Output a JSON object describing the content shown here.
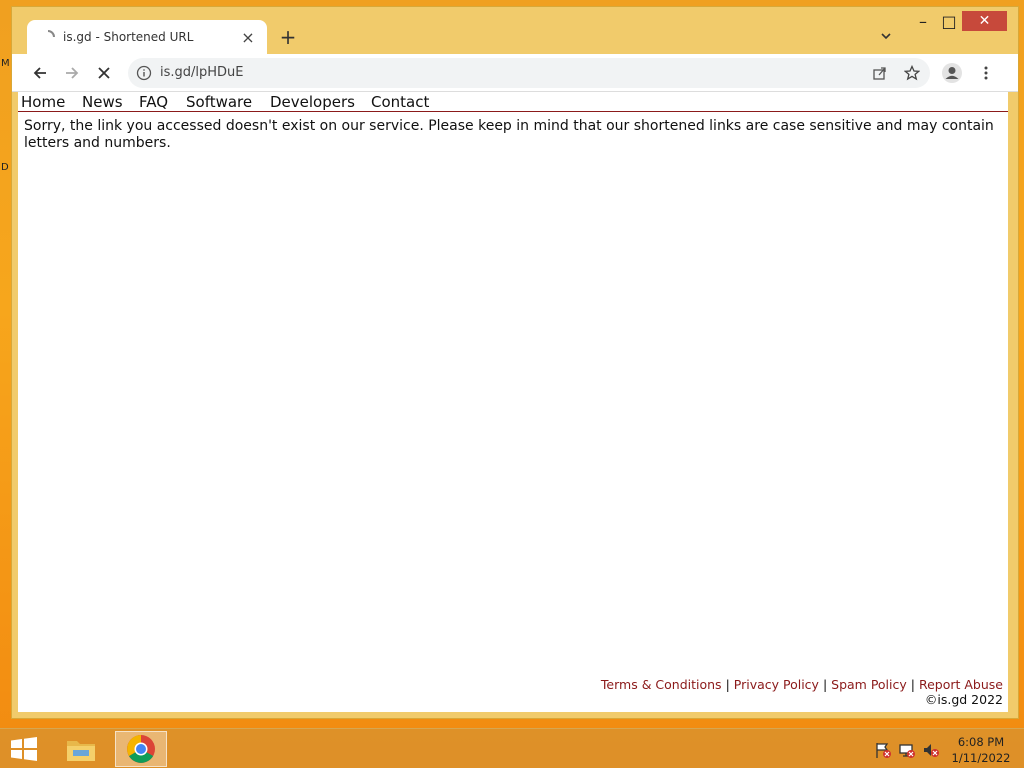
{
  "desktop": {
    "letters": [
      "M",
      "D"
    ]
  },
  "browser": {
    "tab_title": "is.gd - Shortened URL",
    "tab_close": "×",
    "new_tab": "+",
    "url": "is.gd/lpHDuE",
    "window_min": "–",
    "window_max": "□",
    "window_close": "✕"
  },
  "site": {
    "nav": [
      "Home",
      "News",
      "FAQ",
      "Software",
      "Developers",
      "Contact"
    ],
    "message": "Sorry, the link you accessed doesn't exist on our service. Please keep in mind that our shortened links are case sensitive and may contain letters and numbers.",
    "footer_links": [
      "Terms & Conditions",
      "Privacy Policy",
      "Spam Policy",
      "Report Abuse"
    ],
    "separator": "|",
    "copyright": "©is.gd 2022"
  },
  "taskbar": {
    "time": "6:08 PM",
    "date": "1/11/2022"
  },
  "colors": {
    "accent": "#8b1a1a",
    "titlebar": "#f1cb6b",
    "close": "#c7493b"
  },
  "icons": [
    "back-icon",
    "forward-icon",
    "stop-icon",
    "info-icon",
    "share-icon",
    "star-icon",
    "profile-icon",
    "menu-icon",
    "windows-start-icon",
    "file-explorer-icon",
    "chrome-icon",
    "flag-icon",
    "network-icon",
    "volume-muted-icon"
  ]
}
